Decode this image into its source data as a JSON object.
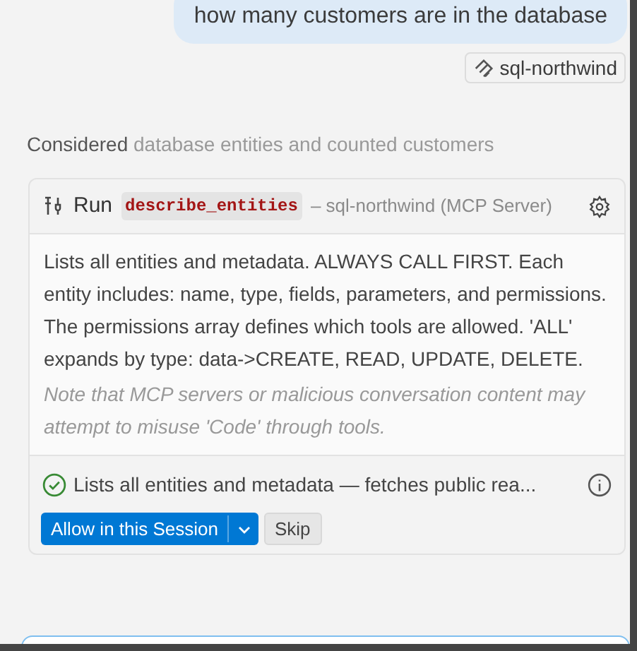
{
  "user_message": {
    "text": "how many customers are in the database"
  },
  "context_chip": {
    "label": "sql-northwind"
  },
  "progress": {
    "verb": "Considered",
    "detail": "database entities and counted customers"
  },
  "tool_card": {
    "action": "Run",
    "tool_name": "describe_entities",
    "source": "– sql-northwind (MCP Server)",
    "description": "Lists all entities and metadata. ALWAYS CALL FIRST. Each entity includes: name, type, fields, parameters, and permissions. The permissions array defines which tools are allowed. 'ALL' expands by type: data->CREATE, READ, UPDATE, DELETE.",
    "warning": "Note that MCP servers or malicious conversation content may attempt to misuse 'Code' through tools.",
    "summary": "Lists all entities and metadata — fetches public rea...",
    "buttons": [
      {
        "label": "Allow in this Session",
        "kind": "primary"
      },
      {
        "label": "Skip",
        "kind": "secondary"
      }
    ]
  }
}
